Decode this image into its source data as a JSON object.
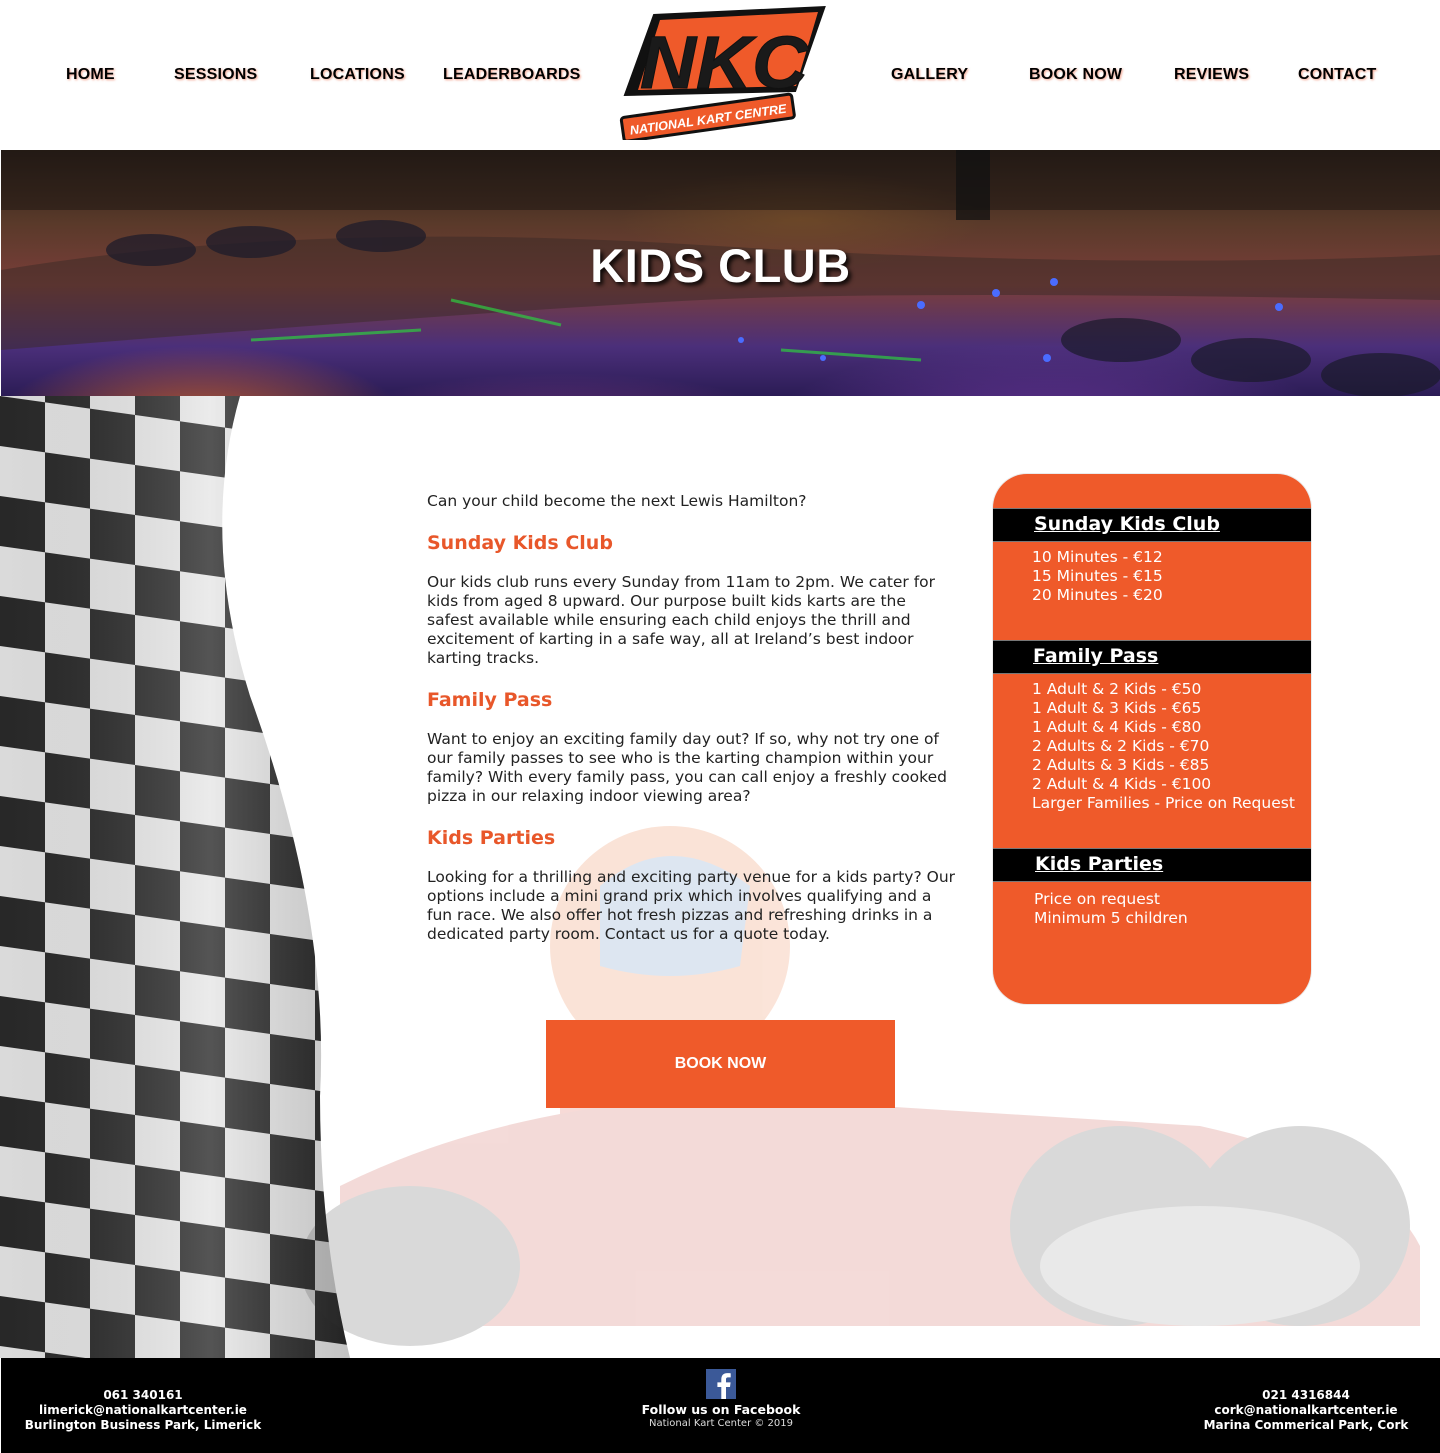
{
  "nav": {
    "home": "HOME",
    "sessions": "SESSIONS",
    "locations": "LOCATIONS",
    "leaderboards": "LEADERBOARDS",
    "gallery": "GALLERY",
    "book_now": "BOOK NOW",
    "reviews": "REVIEWS",
    "contact": "CONTACT"
  },
  "logo": {
    "text": "NKC",
    "tagline": "NATIONAL KART CENTRE"
  },
  "hero": {
    "title": "KIDS CLUB"
  },
  "content": {
    "intro": "Can your child become the next Lewis Hamilton?",
    "sections": [
      {
        "title": "Sunday Kids Club",
        "body": "Our kids club runs every Sunday from 11am to 2pm. We cater for kids from aged 8 upward. Our purpose built kids karts are the safest available while ensuring each child enjoys the thrill and excitement of karting in a safe way, all at Ireland’s best indoor karting tracks."
      },
      {
        "title": "Family Pass",
        "body": "Want to enjoy an exciting family day out? If so, why not try one of our family passes to see who is the karting champion within your family? With every family pass, you can call enjoy a freshly cooked pizza in our relaxing indoor viewing area?"
      },
      {
        "title": "Kids Parties",
        "body": "Looking for a thrilling and exciting party venue for a kids party? Our options include a mini grand prix which involves qualifying and a fun race. We also offer hot fresh pizzas and refreshing drinks in a dedicated party room. Contact us for a quote today."
      }
    ],
    "book_button": "BOOK NOW"
  },
  "pricing": {
    "sunday": {
      "title": "Sunday Kids Club",
      "lines": [
        "10 Minutes - €12",
        "15 Minutes - €15",
        "20 Minutes - €20"
      ]
    },
    "family": {
      "title": "Family Pass",
      "lines": [
        "1 Adult & 2 Kids - €50",
        "1 Adult & 3 Kids - €65",
        "1 Adult & 4 Kids - €80",
        "2 Adults & 2 Kids - €70",
        "2 Adults & 3 Kids - €85",
        "2 Adult & 4 Kids - €100",
        "Larger Families - Price on Request"
      ]
    },
    "parties": {
      "title": "Kids Parties",
      "lines": [
        "Price on request",
        "Minimum 5 children"
      ]
    }
  },
  "footer": {
    "left": {
      "phone": "061 340161",
      "email": "limerick@nationalkartcenter.ie",
      "address": "Burlington Business Park, Limerick"
    },
    "center": {
      "follow": "Follow us on Facebook",
      "copyright": "National Kart Center © 2019"
    },
    "right": {
      "phone": "021 4316844",
      "email": "cork@nationalkartcenter.ie",
      "address": "Marina Commerical Park, Cork"
    }
  },
  "colors": {
    "accent": "#ef5a2a",
    "heading_orange": "#e8572a",
    "footer_bg": "#000000",
    "facebook": "#3b5998"
  },
  "icons": {
    "facebook": "facebook-icon"
  }
}
